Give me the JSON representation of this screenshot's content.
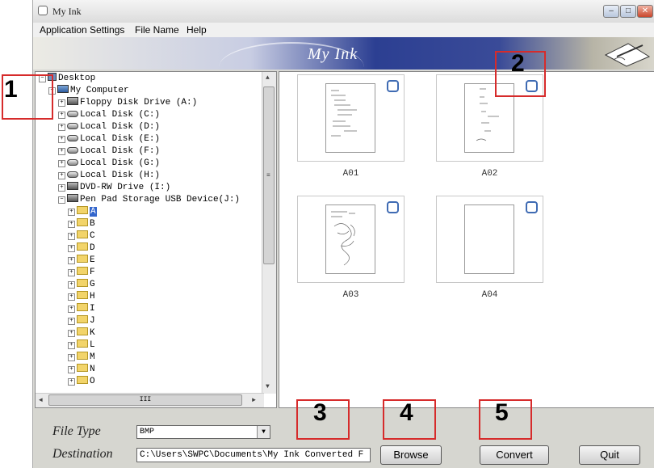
{
  "window": {
    "title": "My Ink"
  },
  "menu": [
    "Application Settings",
    "File Name",
    "Help"
  ],
  "banner": {
    "title": "My Ink"
  },
  "tree": [
    {
      "label": "Desktop",
      "icon": "desktop-icon",
      "level": 0,
      "toggle": "−"
    },
    {
      "label": "My Computer",
      "icon": "computer-icon",
      "level": 1,
      "toggle": "−"
    },
    {
      "label": "Floppy Disk Drive (A:)",
      "icon": "floppy-icon",
      "level": 2,
      "toggle": "+"
    },
    {
      "label": "Local Disk (C:)",
      "icon": "disk-icon",
      "level": 2,
      "toggle": "+"
    },
    {
      "label": "Local Disk (D:)",
      "icon": "disk-icon",
      "level": 2,
      "toggle": "+"
    },
    {
      "label": "Local Disk (E:)",
      "icon": "disk-icon",
      "level": 2,
      "toggle": "+"
    },
    {
      "label": "Local Disk (F:)",
      "icon": "disk-icon",
      "level": 2,
      "toggle": "+"
    },
    {
      "label": "Local Disk (G:)",
      "icon": "disk-icon",
      "level": 2,
      "toggle": "+"
    },
    {
      "label": "Local Disk (H:)",
      "icon": "disk-icon",
      "level": 2,
      "toggle": "+"
    },
    {
      "label": "DVD-RW Drive (I:)",
      "icon": "dvd-icon",
      "level": 2,
      "toggle": "+"
    },
    {
      "label": "Pen Pad Storage USB Device(J:)",
      "icon": "usb-drive-icon",
      "level": 2,
      "toggle": "−"
    },
    {
      "label": "A",
      "icon": "folder-icon",
      "level": 3,
      "toggle": "+",
      "selected": true
    },
    {
      "label": "B",
      "icon": "folder-icon",
      "level": 3,
      "toggle": "+"
    },
    {
      "label": "C",
      "icon": "folder-icon",
      "level": 3,
      "toggle": "+"
    },
    {
      "label": "D",
      "icon": "folder-icon",
      "level": 3,
      "toggle": "+"
    },
    {
      "label": "E",
      "icon": "folder-icon",
      "level": 3,
      "toggle": "+"
    },
    {
      "label": "F",
      "icon": "folder-icon",
      "level": 3,
      "toggle": "+"
    },
    {
      "label": "G",
      "icon": "folder-icon",
      "level": 3,
      "toggle": "+"
    },
    {
      "label": "H",
      "icon": "folder-icon",
      "level": 3,
      "toggle": "+"
    },
    {
      "label": "I",
      "icon": "folder-icon",
      "level": 3,
      "toggle": "+"
    },
    {
      "label": "J",
      "icon": "folder-icon",
      "level": 3,
      "toggle": "+"
    },
    {
      "label": "K",
      "icon": "folder-icon",
      "level": 3,
      "toggle": "+"
    },
    {
      "label": "L",
      "icon": "folder-icon",
      "level": 3,
      "toggle": "+"
    },
    {
      "label": "M",
      "icon": "folder-icon",
      "level": 3,
      "toggle": "+"
    },
    {
      "label": "N",
      "icon": "folder-icon",
      "level": 3,
      "toggle": "+"
    },
    {
      "label": "O",
      "icon": "folder-icon",
      "level": 3,
      "toggle": "+"
    }
  ],
  "scroll": {
    "h_thumb_grip": "III"
  },
  "thumbnails": [
    {
      "label": "A01",
      "checked": false
    },
    {
      "label": "A02",
      "checked": false
    },
    {
      "label": "A03",
      "checked": false
    },
    {
      "label": "A04",
      "checked": false
    }
  ],
  "bottom": {
    "file_type_label": "File Type",
    "file_type_value": "BMP",
    "destination_label": "Destination",
    "destination_value": "C:\\Users\\SWPC\\Documents\\My Ink Converted F",
    "browse": "Browse",
    "convert": "Convert",
    "quit": "Quit"
  },
  "callouts": [
    "1",
    "2",
    "3",
    "4",
    "5"
  ],
  "colors": {
    "callout": "#d62b2b",
    "banner": "#2c3f92",
    "selection": "#3366cc"
  }
}
